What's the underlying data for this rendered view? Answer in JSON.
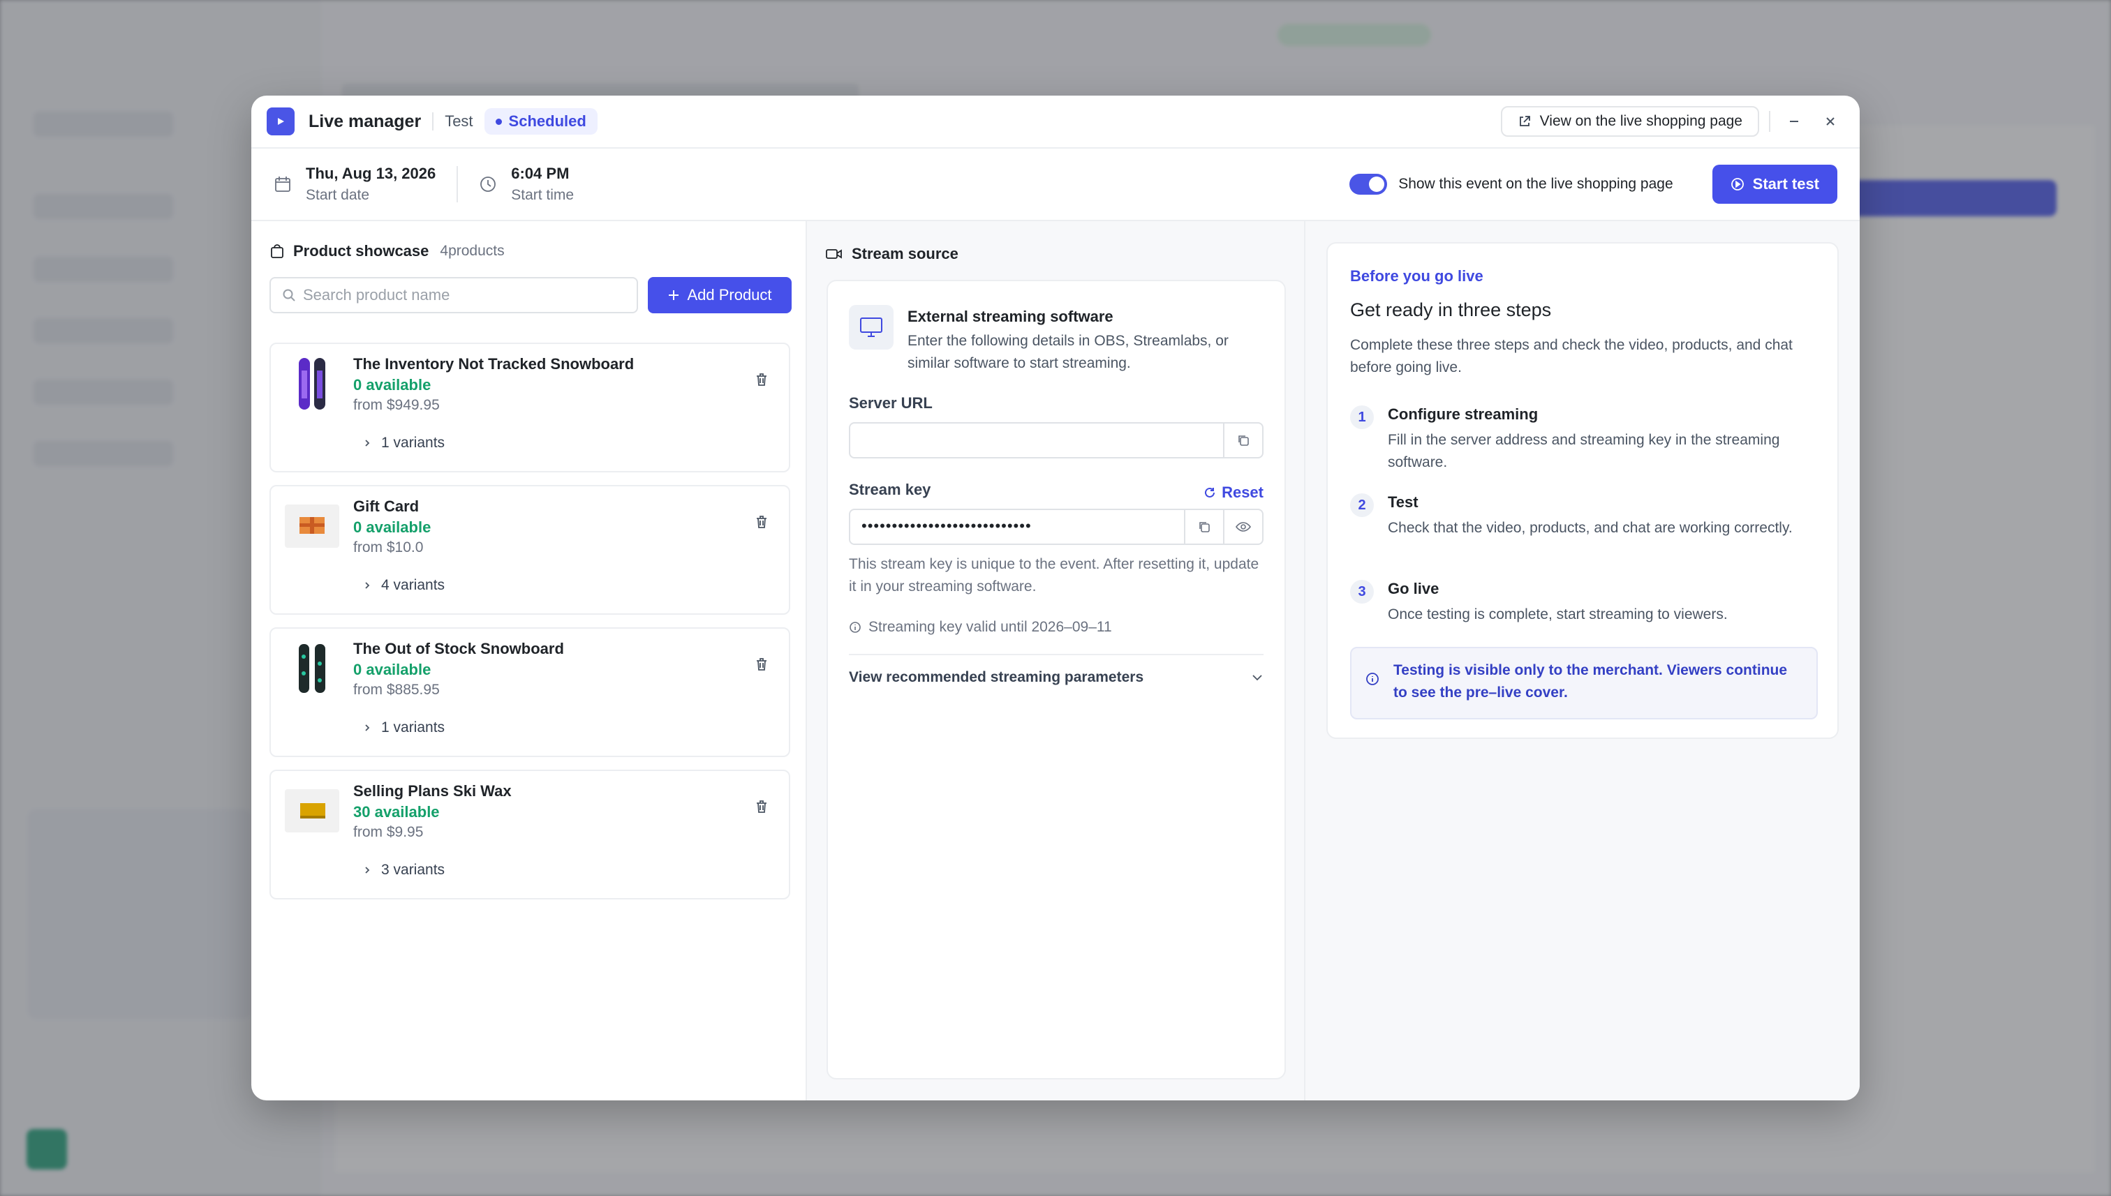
{
  "header": {
    "title": "Live manager",
    "tag": "Test",
    "status": "Scheduled",
    "view_link": "View on the live shopping page"
  },
  "schedule": {
    "date": "Thu, Aug 13, 2026",
    "date_label": "Start date",
    "time": "6:04 PM",
    "time_label": "Start time",
    "toggle_label": "Show this event on the live shopping page",
    "toggle_on": true,
    "start_test": "Start test"
  },
  "showcase": {
    "title": "Product showcase",
    "count": "4products",
    "search_placeholder": "Search product name",
    "add_button": "Add Product",
    "products": [
      {
        "name": "The Inventory Not Tracked Snowboard",
        "available": "0 available",
        "price": "from $949.95",
        "variants": "1 variants",
        "icon": "snowboard-purple"
      },
      {
        "name": "Gift Card",
        "available": "0 available",
        "price": "from $10.0",
        "variants": "4 variants",
        "icon": "gift-card"
      },
      {
        "name": "The Out of Stock Snowboard",
        "available": "0 available",
        "price": "from $885.95",
        "variants": "1 variants",
        "icon": "snowboard-dark"
      },
      {
        "name": "Selling Plans Ski Wax",
        "available": "30 available",
        "price": "from $9.95",
        "variants": "3 variants",
        "icon": "ski-wax"
      }
    ]
  },
  "stream": {
    "title": "Stream source",
    "source_title": "External streaming software",
    "source_desc": "Enter the following details in OBS, Streamlabs, or similar software to start streaming.",
    "server_url_label": "Server URL",
    "server_url_value": "",
    "stream_key_label": "Stream key",
    "reset_label": "Reset",
    "stream_key_masked": "••••••••••••••••••••••••••••",
    "hint": "This stream key is unique to the event. After resetting it, update it in your streaming software.",
    "valid_until": "Streaming key valid until 2026–09–11",
    "params_label": "View recommended streaming parameters"
  },
  "ready": {
    "eyebrow": "Before you go live",
    "title": "Get ready in three steps",
    "desc": "Complete these three steps and check the video, products, and chat before going live.",
    "steps": [
      {
        "num": "1",
        "title": "Configure streaming",
        "desc": "Fill in the server address and streaming key in the streaming software."
      },
      {
        "num": "2",
        "title": "Test",
        "desc": "Check that the video, products, and chat are working correctly."
      },
      {
        "num": "3",
        "title": "Go live",
        "desc": "Once testing is complete, start streaming to viewers."
      }
    ],
    "note": "Testing is visible only to the merchant. Viewers continue to see the pre–live cover."
  },
  "colors": {
    "accent": "#4650ea",
    "success": "#14a06a",
    "note_text": "#3440c4"
  }
}
